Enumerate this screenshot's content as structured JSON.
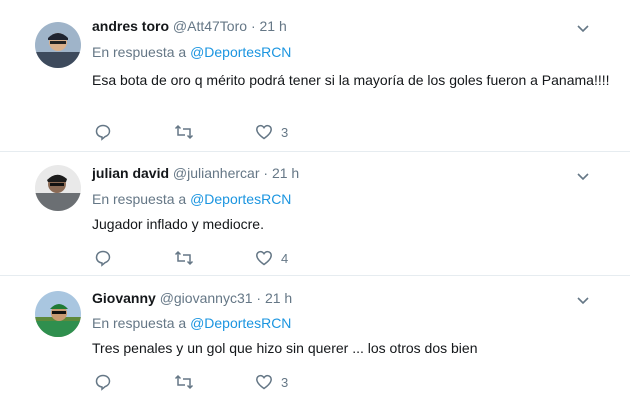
{
  "tweets": [
    {
      "name": "andres toro",
      "handle": "@Att47Toro",
      "dot": "·",
      "time": "21 h",
      "reply_prefix": "En respuesta a",
      "reply_mention": "@DeportesRCN",
      "text": "Esa bota de oro q mérito podrá tener si la mayoría de los goles fueron a Panama!!!!",
      "likes": "3"
    },
    {
      "name": "julian david",
      "handle": "@julianhercar",
      "dot": "·",
      "time": "21 h",
      "reply_prefix": "En respuesta a",
      "reply_mention": "@DeportesRCN",
      "text": "Jugador inflado y mediocre.",
      "likes": "4"
    },
    {
      "name": "Giovanny",
      "handle": "@giovannyc31",
      "dot": "·",
      "time": "21 h",
      "reply_prefix": "En respuesta a",
      "reply_mention": "@DeportesRCN",
      "text": "Tres penales y un gol que hizo sin querer ... los otros dos bien",
      "likes": "3"
    }
  ],
  "icons": {
    "reply": "reply-icon",
    "retweet": "retweet-icon",
    "like": "heart-icon",
    "caret": "chevron-down-icon"
  },
  "colors": {
    "mention": "#1b95e0",
    "secondary_text": "#657786",
    "divider": "#e6ecf0"
  }
}
